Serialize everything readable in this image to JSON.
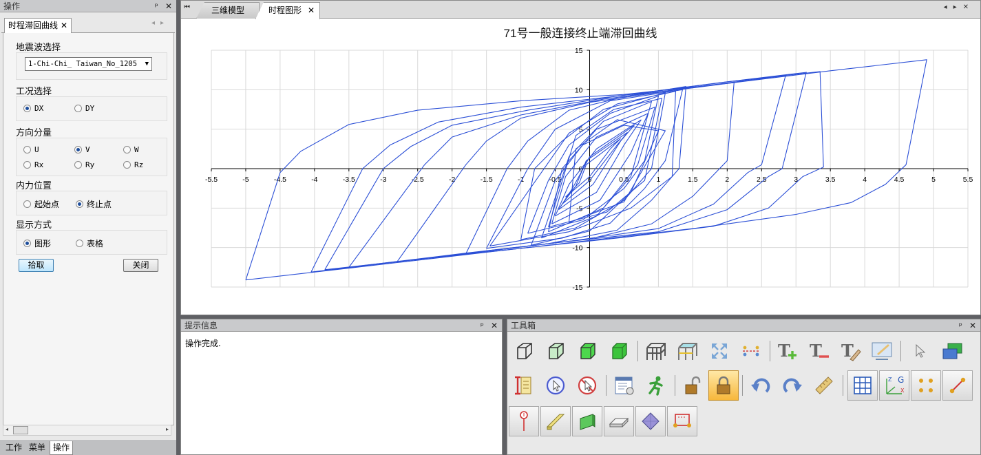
{
  "left_panel": {
    "title": "操作",
    "pin": "ᵖ",
    "close": "✕",
    "tab_label": "时程滞回曲线",
    "tab_close": "✕",
    "groups": {
      "wave": {
        "title": "地震波选择",
        "selected": "1-Chi-Chi_ Taiwan_No_1205"
      },
      "case": {
        "title": "工况选择",
        "options": [
          "DX",
          "DY"
        ],
        "selected": "DX"
      },
      "direction": {
        "title": "方向分量",
        "options": [
          "U",
          "V",
          "W",
          "Rx",
          "Ry",
          "Rz"
        ],
        "selected": "V"
      },
      "position": {
        "title": "内力位置",
        "options": [
          "起始点",
          "终止点"
        ],
        "selected": "终止点"
      },
      "display": {
        "title": "显示方式",
        "options": [
          "图形",
          "表格"
        ],
        "selected": "图形"
      }
    },
    "buttons": {
      "pick": "拾取",
      "close": "关闭"
    },
    "bottom_tabs": [
      "工作",
      "菜单",
      "操作"
    ],
    "active_bottom_tab": "操作"
  },
  "document": {
    "tabs": [
      {
        "label": "三维模型"
      },
      {
        "label": "时程图形"
      }
    ],
    "active_tab": "时程图形",
    "tab_close": "✕"
  },
  "message_panel": {
    "title": "提示信息",
    "text": "操作完成."
  },
  "toolbox": {
    "title": "工具箱",
    "row1": [
      "wireframe-cube-icon",
      "edge-cube-icon",
      "green-cube-icon",
      "solid-green-cube-icon",
      "frame-structure-icon",
      "shaded-frame-icon",
      "zoom-extents-icon",
      "dimension-icon",
      "add-text-icon",
      "remove-text-icon",
      "clear-text-icon",
      "pencil-screen-icon",
      "pointer-icon",
      "layers-icon"
    ],
    "row2": [
      "element-info-icon",
      "select-circle-icon",
      "no-select-icon",
      "properties-window-icon",
      "run-man-icon",
      "unlock-icon",
      "lock-icon",
      "undo-icon",
      "redo-icon",
      "measure-ruler-icon",
      "grid-icon",
      "axis-gxyz-icon",
      "nodes-icon",
      "line-element-icon"
    ],
    "row3": [
      "point-load-icon",
      "beam-element-icon",
      "plate-element-icon",
      "slab-element-icon",
      "solid-element-icon",
      "spring-link-icon"
    ]
  },
  "colors": {
    "curve": "#2b4fd6",
    "accent": "#1d4d9b"
  },
  "chart_data": {
    "type": "line",
    "title": "71号一般连接终止端滞回曲线",
    "xlim": [
      -5.5,
      5.5
    ],
    "ylim": [
      -15,
      15
    ],
    "xticks": [
      -5.5,
      -5,
      -4.5,
      -4,
      -3.5,
      -3,
      -2.5,
      -2,
      -1.5,
      -1,
      -0.5,
      0,
      0.5,
      1,
      1.5,
      2,
      2.5,
      3,
      3.5,
      4,
      4.5,
      5,
      5.5
    ],
    "yticks": [
      -15,
      -10,
      -5,
      0,
      5,
      10,
      15
    ],
    "grid": true,
    "series": [
      {
        "values": [
          [
            -5,
            -14.1
          ],
          [
            -2.8,
            -11.9
          ],
          [
            -1.5,
            -10.6
          ],
          [
            0,
            -9.1
          ],
          [
            1.5,
            -7.6
          ],
          [
            3,
            -5.8
          ],
          [
            3.8,
            -4.3
          ],
          [
            4.3,
            -2
          ],
          [
            4.6,
            0.5
          ],
          [
            4.9,
            13.8
          ],
          [
            3.5,
            12.4
          ],
          [
            2,
            10.8
          ],
          [
            0.5,
            9.4
          ],
          [
            -1,
            8.6
          ],
          [
            -2.5,
            7.4
          ],
          [
            -3.5,
            5.6
          ],
          [
            -4.2,
            2.2
          ],
          [
            -4.5,
            -0.5
          ],
          [
            -5,
            -14.1
          ]
        ]
      },
      {
        "values": [
          [
            -4.05,
            -13.1
          ],
          [
            -2.5,
            -11.5
          ],
          [
            -1,
            -10.1
          ],
          [
            0.5,
            -8.7
          ],
          [
            1.8,
            -7.3
          ],
          [
            2.6,
            -5
          ],
          [
            3.1,
            -1
          ],
          [
            3.4,
            0.2
          ],
          [
            3.35,
            12.3
          ],
          [
            2,
            11
          ],
          [
            0.5,
            9.3
          ],
          [
            -1,
            7.8
          ],
          [
            -2.2,
            5.9
          ],
          [
            -2.9,
            3
          ],
          [
            -3.3,
            0
          ],
          [
            -4.05,
            -13.1
          ]
        ]
      },
      {
        "values": [
          [
            -3.85,
            -12.8
          ],
          [
            -2,
            -11
          ],
          [
            -0.5,
            -9.4
          ],
          [
            1,
            -8
          ],
          [
            2,
            -5.2
          ],
          [
            2.6,
            -1
          ],
          [
            2.8,
            0
          ],
          [
            3.15,
            12.2
          ],
          [
            1.9,
            10.9
          ],
          [
            0.4,
            9.2
          ],
          [
            -0.9,
            7.4
          ],
          [
            -2,
            5.5
          ],
          [
            -2.6,
            2.8
          ],
          [
            -3,
            0
          ],
          [
            -3.85,
            -12.8
          ]
        ]
      },
      {
        "values": [
          [
            -3.5,
            -12.5
          ],
          [
            -1.8,
            -10.7
          ],
          [
            -0.3,
            -9.2
          ],
          [
            1,
            -7.6
          ],
          [
            1.8,
            -4.5
          ],
          [
            2.3,
            -0.5
          ],
          [
            2.5,
            0.5
          ],
          [
            2.85,
            11.8
          ],
          [
            1.5,
            10.3
          ],
          [
            0.2,
            8.8
          ],
          [
            -1,
            6.8
          ],
          [
            -2,
            4
          ],
          [
            -2.4,
            0.5
          ],
          [
            -3.5,
            -12.5
          ]
        ]
      },
      {
        "values": [
          [
            -2.8,
            -11.8
          ],
          [
            -1.3,
            -10.2
          ],
          [
            0,
            -8.9
          ],
          [
            0.9,
            -7
          ],
          [
            1.5,
            -3.5
          ],
          [
            2,
            1
          ],
          [
            2.1,
            10.9
          ],
          [
            1.2,
            9.9
          ],
          [
            0,
            8.4
          ],
          [
            -1,
            6.4
          ],
          [
            -1.5,
            3.5
          ],
          [
            -1.8,
            0.5
          ],
          [
            -2.8,
            -11.8
          ]
        ]
      },
      {
        "values": [
          [
            -1.8,
            -10.8
          ],
          [
            -0.6,
            -9.5
          ],
          [
            0.4,
            -7.8
          ],
          [
            0.9,
            -4
          ],
          [
            1.3,
            0
          ],
          [
            1.4,
            10.4
          ],
          [
            0.6,
            9.3
          ],
          [
            -0.3,
            7.4
          ],
          [
            -0.9,
            3.5
          ],
          [
            -1.2,
            0
          ],
          [
            -1.8,
            -10.8
          ]
        ]
      },
      {
        "values": [
          [
            -1.5,
            -10.1
          ],
          [
            -0.4,
            -8.8
          ],
          [
            0.3,
            -6.9
          ],
          [
            0.8,
            -2.5
          ],
          [
            1.1,
            1
          ],
          [
            1.35,
            10
          ],
          [
            0.3,
            8.6
          ],
          [
            -0.5,
            5
          ],
          [
            -0.9,
            0
          ],
          [
            -1.5,
            -10.1
          ]
        ]
      },
      {
        "values": [
          [
            -1,
            -9
          ],
          [
            -0.2,
            -7.5
          ],
          [
            0.5,
            -4
          ],
          [
            0.9,
            0
          ],
          [
            1.1,
            9.6
          ],
          [
            0.2,
            7.5
          ],
          [
            -0.4,
            3.5
          ],
          [
            -0.8,
            0
          ],
          [
            -1,
            -9
          ]
        ]
      },
      {
        "values": [
          [
            -0.9,
            -8.2
          ],
          [
            -0.1,
            -6.5
          ],
          [
            0.5,
            -2.5
          ],
          [
            0.8,
            1
          ],
          [
            1,
            9.2
          ],
          [
            0.3,
            7
          ],
          [
            -0.3,
            3
          ],
          [
            -0.6,
            -1.5
          ],
          [
            -0.9,
            -8.2
          ]
        ]
      },
      {
        "values": [
          [
            -0.85,
            -9.7
          ],
          [
            0,
            -7.9
          ],
          [
            0.6,
            -3
          ],
          [
            1,
            4.8
          ],
          [
            0.5,
            5.5
          ],
          [
            -0.1,
            3
          ],
          [
            -0.5,
            -1.5
          ],
          [
            -0.85,
            -9.7
          ]
        ]
      },
      {
        "values": [
          [
            -0.7,
            -8.8
          ],
          [
            0.1,
            -6
          ],
          [
            0.6,
            -1
          ],
          [
            0.9,
            8.5
          ],
          [
            0.2,
            6
          ],
          [
            -0.3,
            1.5
          ],
          [
            -0.7,
            -8.8
          ]
        ]
      },
      {
        "values": [
          [
            -0.6,
            -8
          ],
          [
            0.2,
            -5
          ],
          [
            0.7,
            0.5
          ],
          [
            0.95,
            7.8
          ],
          [
            0.1,
            5
          ],
          [
            -0.4,
            0
          ],
          [
            -0.6,
            -8
          ]
        ]
      },
      {
        "values": [
          [
            -0.55,
            -7
          ],
          [
            0.15,
            -4
          ],
          [
            0.6,
            2
          ],
          [
            0.85,
            7
          ],
          [
            0.1,
            4
          ],
          [
            -0.35,
            -1
          ],
          [
            -0.55,
            -7
          ]
        ]
      },
      {
        "values": [
          [
            -0.5,
            -6
          ],
          [
            0.1,
            -3
          ],
          [
            0.5,
            3
          ],
          [
            0.75,
            6.2
          ],
          [
            0.1,
            2.5
          ],
          [
            -0.3,
            -2
          ],
          [
            -0.5,
            -6
          ]
        ]
      },
      {
        "values": [
          [
            -0.45,
            -5.2
          ],
          [
            0.05,
            -2
          ],
          [
            0.45,
            3.5
          ],
          [
            0.65,
            5.5
          ],
          [
            0,
            1.5
          ],
          [
            -0.25,
            -2.5
          ],
          [
            -0.45,
            -5.2
          ]
        ]
      },
      {
        "values": [
          [
            -0.4,
            -4.5
          ],
          [
            0,
            -1.5
          ],
          [
            0.4,
            3
          ],
          [
            0.55,
            4.6
          ],
          [
            -0.05,
            1
          ],
          [
            -0.2,
            -2.2
          ],
          [
            -0.4,
            -4.5
          ]
        ]
      },
      {
        "values": [
          [
            -0.35,
            -3.6
          ],
          [
            0,
            -1
          ],
          [
            0.3,
            2.5
          ],
          [
            0.45,
            3.8
          ],
          [
            -0.05,
            0.5
          ],
          [
            -0.15,
            -1.8
          ],
          [
            -0.35,
            -3.6
          ]
        ]
      },
      {
        "values": [
          [
            -0.6,
            -7.4
          ],
          [
            0.25,
            -5.5
          ],
          [
            0.8,
            -1.5
          ],
          [
            1.05,
            8.9
          ],
          [
            0.35,
            7.5
          ],
          [
            -0.2,
            4.2
          ],
          [
            -0.6,
            -7.4
          ]
        ]
      },
      {
        "values": [
          [
            -1.45,
            -9.8
          ],
          [
            -0.3,
            -8
          ],
          [
            0.6,
            -5
          ],
          [
            1.2,
            -1
          ],
          [
            1.25,
            9.8
          ],
          [
            0.4,
            8.2
          ],
          [
            -0.3,
            4.5
          ],
          [
            -1.45,
            -9.8
          ]
        ]
      },
      {
        "values": [
          [
            -0.3,
            -6.8
          ],
          [
            0.5,
            -4.2
          ],
          [
            1.1,
            4.8
          ],
          [
            0.4,
            6.2
          ],
          [
            -0.2,
            2.5
          ],
          [
            -0.3,
            -6.8
          ]
        ]
      }
    ]
  }
}
